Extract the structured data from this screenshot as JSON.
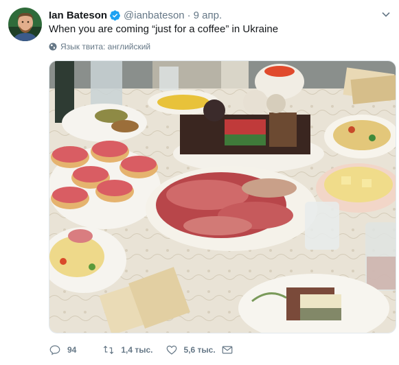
{
  "tweet": {
    "author_name": "Ian Bateson",
    "handle": "@ianbateson",
    "separator": "·",
    "date": "9 апр.",
    "text": "When you are coming “just for a coffee” in Ukraine",
    "language_note": "Язык твита: английский",
    "verified": true
  },
  "icons": {
    "verified": "verified-badge-icon",
    "caret": "chevron-down-icon",
    "globe": "globe-icon",
    "reply": "reply-icon",
    "retweet": "retweet-icon",
    "like": "heart-icon",
    "dm": "envelope-icon"
  },
  "actions": {
    "reply_count": "94",
    "retweet_count": "1,4 тыс.",
    "like_count": "5,6 тыс."
  },
  "colors": {
    "accent": "#1da1f2",
    "muted": "#657786",
    "text": "#14171a"
  }
}
